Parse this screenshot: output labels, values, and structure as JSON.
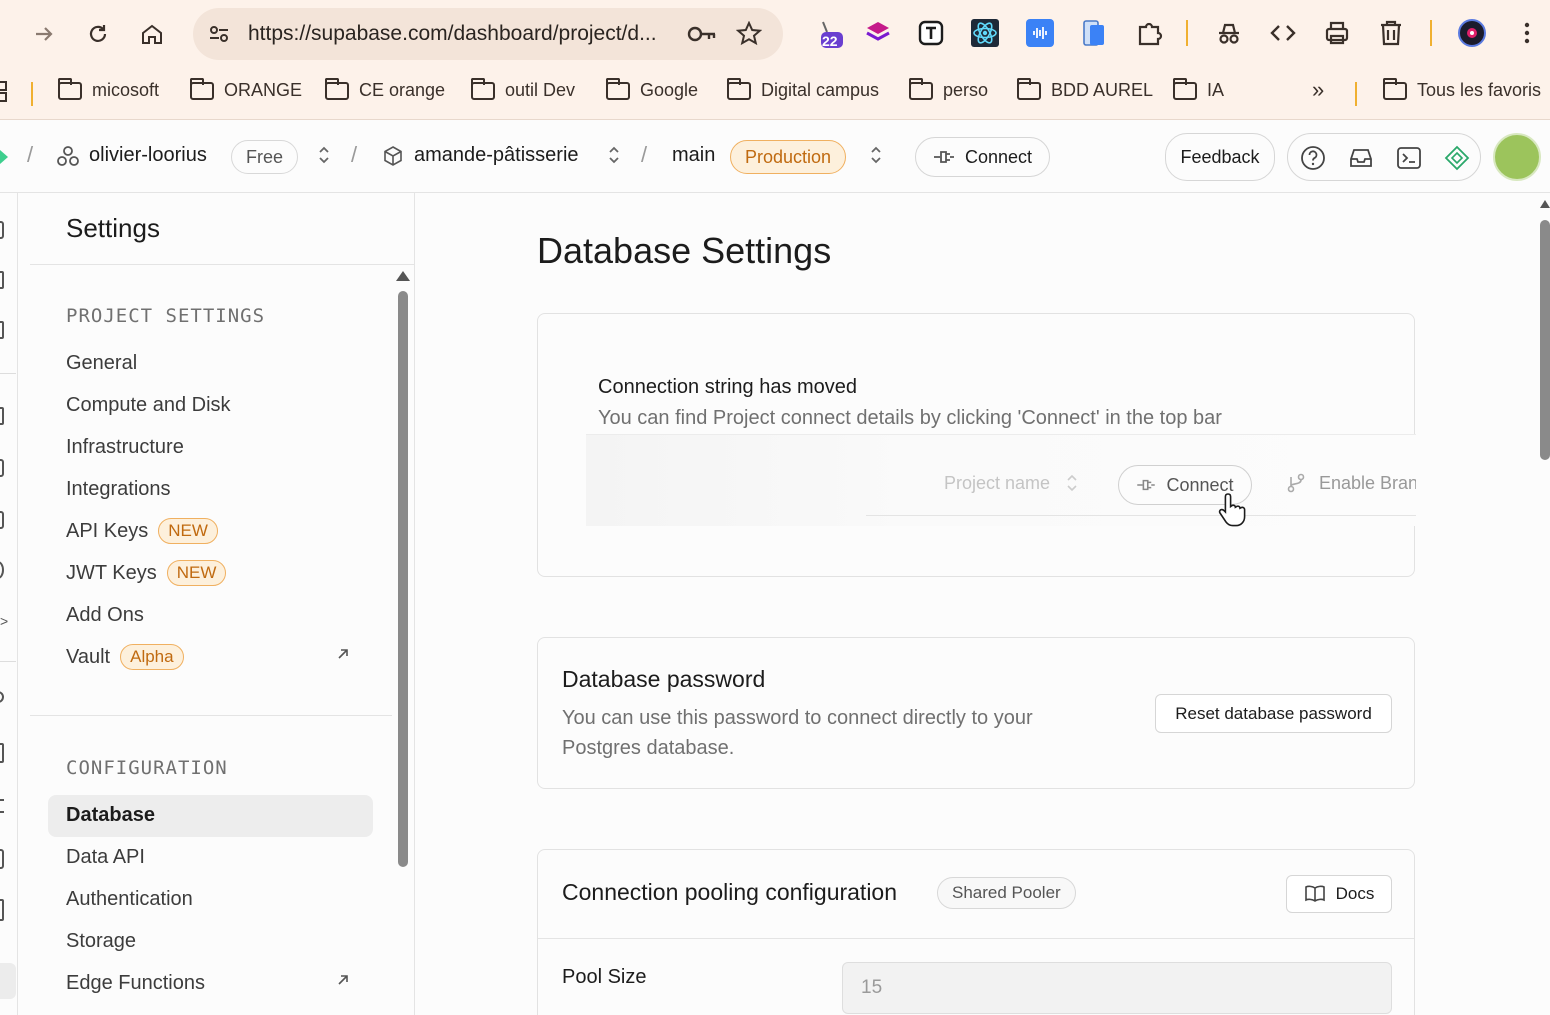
{
  "browser": {
    "url": "https://supabase.com/dashboard/project/d...",
    "extension_badge": "22",
    "bookmarks": [
      "micosoft",
      "ORANGE",
      "CE orange",
      "outil Dev",
      "Google",
      "Digital campus",
      "perso",
      "BDD AUREL",
      "IA"
    ],
    "more_bookmarks": "»",
    "all_bookmarks": "Tous les favoris"
  },
  "appbar": {
    "org": "olivier-loorius",
    "plan": "Free",
    "project": "amande-pâtisserie",
    "branch": "main",
    "env": "Production",
    "connect": "Connect",
    "feedback": "Feedback"
  },
  "sidebar": {
    "title": "Settings",
    "project_label": "PROJECT SETTINGS",
    "project_items": [
      {
        "label": "General"
      },
      {
        "label": "Compute and Disk"
      },
      {
        "label": "Infrastructure"
      },
      {
        "label": "Integrations"
      },
      {
        "label": "API Keys",
        "badge": "NEW"
      },
      {
        "label": "JWT Keys",
        "badge": "NEW"
      },
      {
        "label": "Add Ons"
      },
      {
        "label": "Vault",
        "badge": "Alpha"
      }
    ],
    "config_label": "CONFIGURATION",
    "config_items": [
      {
        "label": "Database"
      },
      {
        "label": "Data API"
      },
      {
        "label": "Authentication"
      },
      {
        "label": "Storage"
      },
      {
        "label": "Edge Functions"
      }
    ]
  },
  "main": {
    "title": "Database Settings",
    "moved_card": {
      "title": "Connection string has moved",
      "text": "You can find Project connect details by clicking 'Connect' in the top bar",
      "preview_project": "Project name",
      "preview_connect": "Connect",
      "preview_branch": "Enable Bran"
    },
    "password_card": {
      "title": "Database password",
      "text": "You can use this password to connect directly to your Postgres database.",
      "button": "Reset database password"
    },
    "pooling_card": {
      "title": "Connection pooling configuration",
      "badge": "Shared Pooler",
      "docs": "Docs",
      "pool_size_label": "Pool Size",
      "pool_size_value": "15"
    }
  }
}
